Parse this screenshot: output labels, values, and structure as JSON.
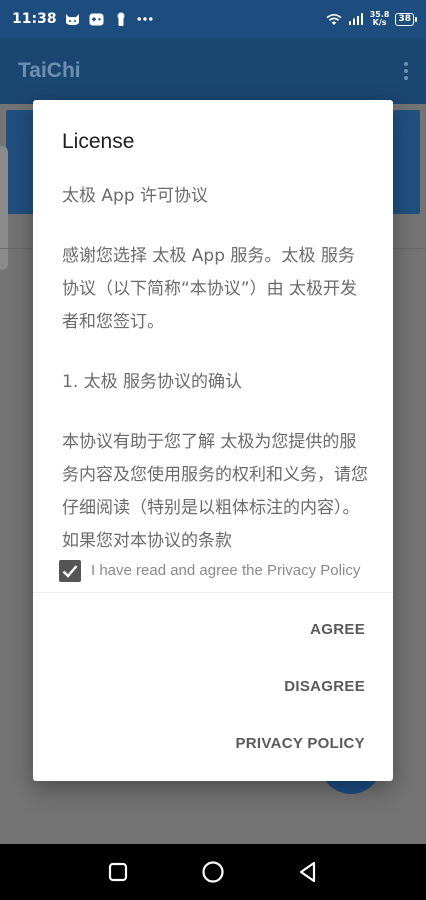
{
  "status_bar": {
    "time": "11:38",
    "net_speed_value": "35.8",
    "net_speed_unit": "K/s",
    "battery": "38"
  },
  "app_bar": {
    "title": "TaiChi"
  },
  "dialog": {
    "title": "License",
    "paragraphs": [
      "太极 App 许可协议",
      "感谢您选择 太极 App 服务。太极 服务协议（以下简称“本协议”）由 太极开发者和您签订。",
      "1. 太极 服务协议的确认",
      "本协议有助于您了解 太极为您提供的服务内容及您使用服务的权利和义务，请您仔细阅读（特别是以粗体标注的内容）。如果您对本协议的条款"
    ],
    "agree_checkbox_label": "I have read and agree the Privacy Policy",
    "agree_checked": true,
    "buttons": {
      "agree": "AGREE",
      "disagree": "DISAGREE",
      "privacy_policy": "PRIVACY POLICY"
    }
  },
  "colors": {
    "status_bar": "#1d4d7e",
    "accent": "#1d4f86",
    "dialog_text": "#6b6b6b"
  }
}
